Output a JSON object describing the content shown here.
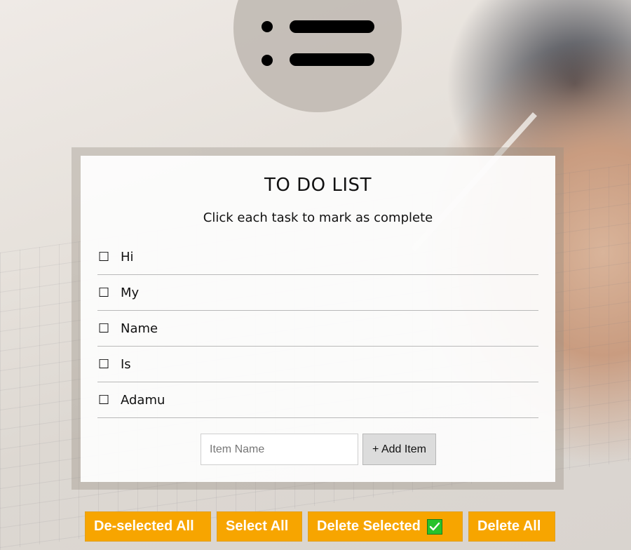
{
  "logo": {
    "icon": "list-icon"
  },
  "todo": {
    "title": "TO DO LIST",
    "subtitle": "Click each task to mark as complete",
    "checkbox_glyph": "☐",
    "items": [
      {
        "label": "Hi",
        "checked": false
      },
      {
        "label": "My",
        "checked": false
      },
      {
        "label": "Name",
        "checked": false
      },
      {
        "label": "Is",
        "checked": false
      },
      {
        "label": "Adamu",
        "checked": false
      }
    ],
    "input": {
      "placeholder": "Item Name",
      "value": ""
    },
    "add_button": "+ Add Item"
  },
  "actions": {
    "deselect_all": "De-selected All",
    "select_all": "Select All",
    "delete_selected": "Delete Selected",
    "delete_all": "Delete All"
  },
  "colors": {
    "action_button": "#f7a500",
    "check_icon": "#27c22b"
  }
}
